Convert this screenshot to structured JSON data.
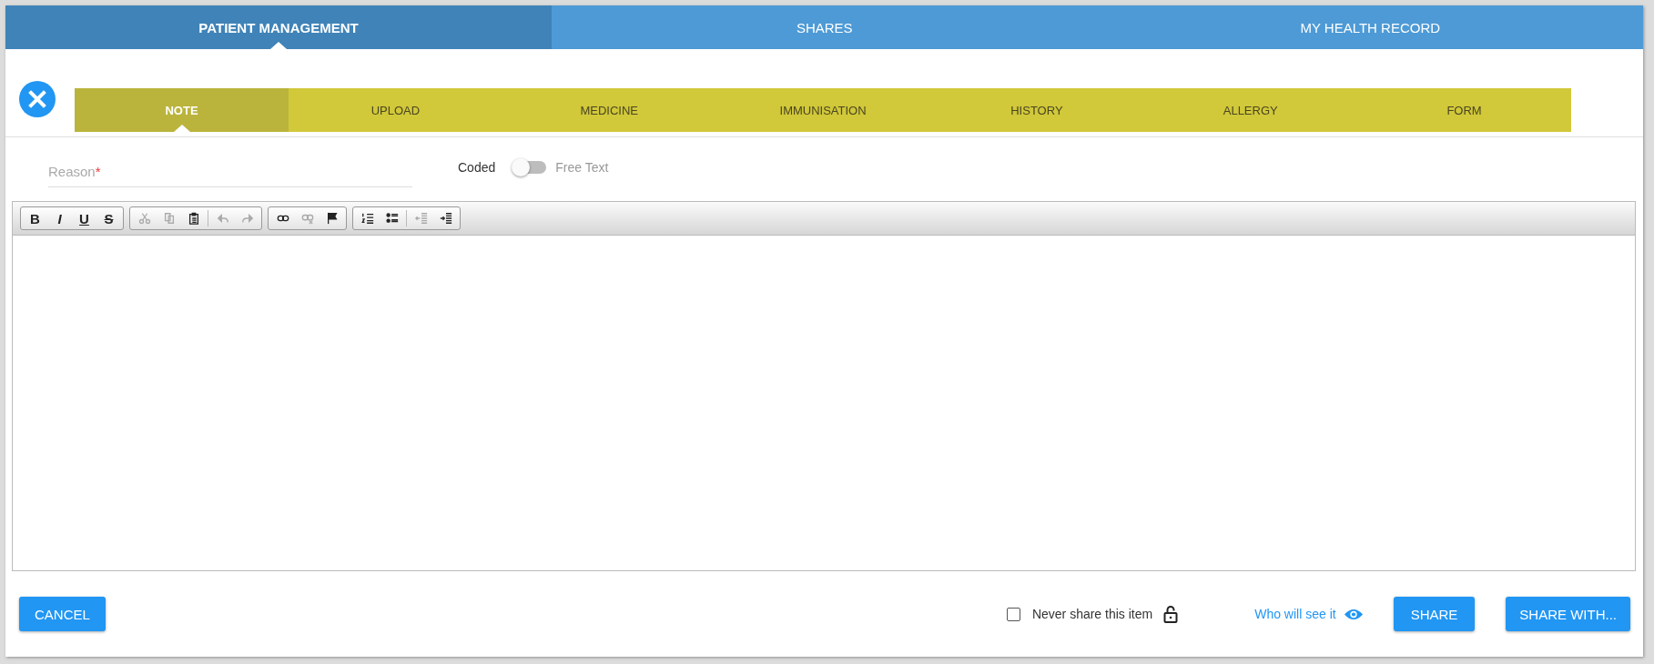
{
  "main_tabs": [
    {
      "label": "PATIENT MANAGEMENT",
      "selected": true
    },
    {
      "label": "SHARES",
      "selected": false
    },
    {
      "label": "MY HEALTH RECORD",
      "selected": false
    }
  ],
  "sub_tabs": [
    {
      "label": "NOTE",
      "selected": true
    },
    {
      "label": "UPLOAD",
      "selected": false
    },
    {
      "label": "MEDICINE",
      "selected": false
    },
    {
      "label": "IMMUNISATION",
      "selected": false
    },
    {
      "label": "HISTORY",
      "selected": false
    },
    {
      "label": "ALLERGY",
      "selected": false
    },
    {
      "label": "FORM",
      "selected": false
    }
  ],
  "reason": {
    "placeholder": "Reason",
    "required_mark": "*"
  },
  "mode_toggle": {
    "left_label": "Coded",
    "right_label": "Free Text",
    "on": false
  },
  "toolbar": [
    [
      {
        "kind": "bold",
        "label": "B",
        "disabled": false
      },
      {
        "kind": "italic",
        "label": "I",
        "disabled": false
      },
      {
        "kind": "underline",
        "label": "U",
        "disabled": false
      },
      {
        "kind": "strike",
        "label": "S",
        "disabled": false
      }
    ],
    [
      {
        "kind": "cut",
        "disabled": true
      },
      {
        "kind": "copy",
        "disabled": true
      },
      {
        "kind": "paste",
        "disabled": false
      },
      {
        "kind": "sep"
      },
      {
        "kind": "undo",
        "disabled": true
      },
      {
        "kind": "redo",
        "disabled": true
      }
    ],
    [
      {
        "kind": "link",
        "disabled": false
      },
      {
        "kind": "unlink",
        "disabled": true
      },
      {
        "kind": "flag",
        "disabled": false
      }
    ],
    [
      {
        "kind": "ol",
        "disabled": false
      },
      {
        "kind": "ul",
        "disabled": false
      },
      {
        "kind": "sep"
      },
      {
        "kind": "outdent",
        "disabled": true
      },
      {
        "kind": "indent",
        "disabled": false
      }
    ]
  ],
  "cancel_label": "CANCEL",
  "never_share": {
    "label": "Never share this item",
    "checked": false
  },
  "who_link": "Who will see it",
  "share_label": "SHARE",
  "share_with_label": "SHARE WITH..."
}
